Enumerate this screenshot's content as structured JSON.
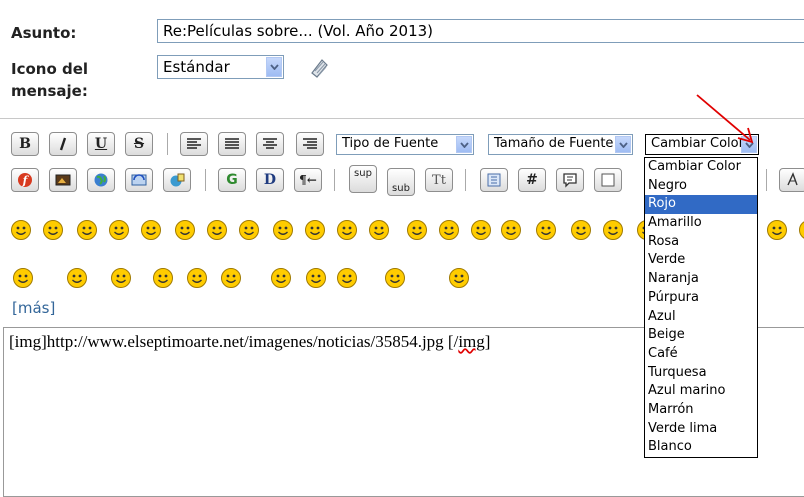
{
  "form": {
    "subject_label": "Asunto:",
    "subject_value": "Re:Películas sobre... (Vol. Año 2013)",
    "icon_label_line1": "Icono del",
    "icon_label_line2": "mensaje:",
    "icon_value": "Estándar"
  },
  "toolbar": {
    "bold": "B",
    "italic": "I",
    "underline": "U",
    "strike": "S",
    "font_type": "Tipo de Fuente",
    "font_size": "Tamaño de Fuente",
    "change_color": "Cambiar Color",
    "sup": "sup",
    "sub": "sub",
    "tt": "Tt",
    "hash": "#",
    "flash": "f",
    "g": "G",
    "d": "D",
    "rtl": "¶←"
  },
  "color_options": [
    "Cambiar Color",
    "Negro",
    "Rojo",
    "Amarillo",
    "Rosa",
    "Verde",
    "Naranja",
    "Púrpura",
    "Azul",
    "Beige",
    "Café",
    "Turquesa",
    "Azul marino",
    "Marrón",
    "Verde lima",
    "Blanco"
  ],
  "selected_color": "Rojo",
  "more_link": "[más]",
  "editor": {
    "text_main": "[img]http://www.elseptimoarte.net/imagenes/noticias/35854.jpg [/",
    "text_spell": "img",
    "text_end": "]"
  },
  "colors": {
    "arrow_red": "#e00000",
    "highlight": "#316ac5",
    "link": "#336699",
    "smiley": "#ffcc00"
  }
}
